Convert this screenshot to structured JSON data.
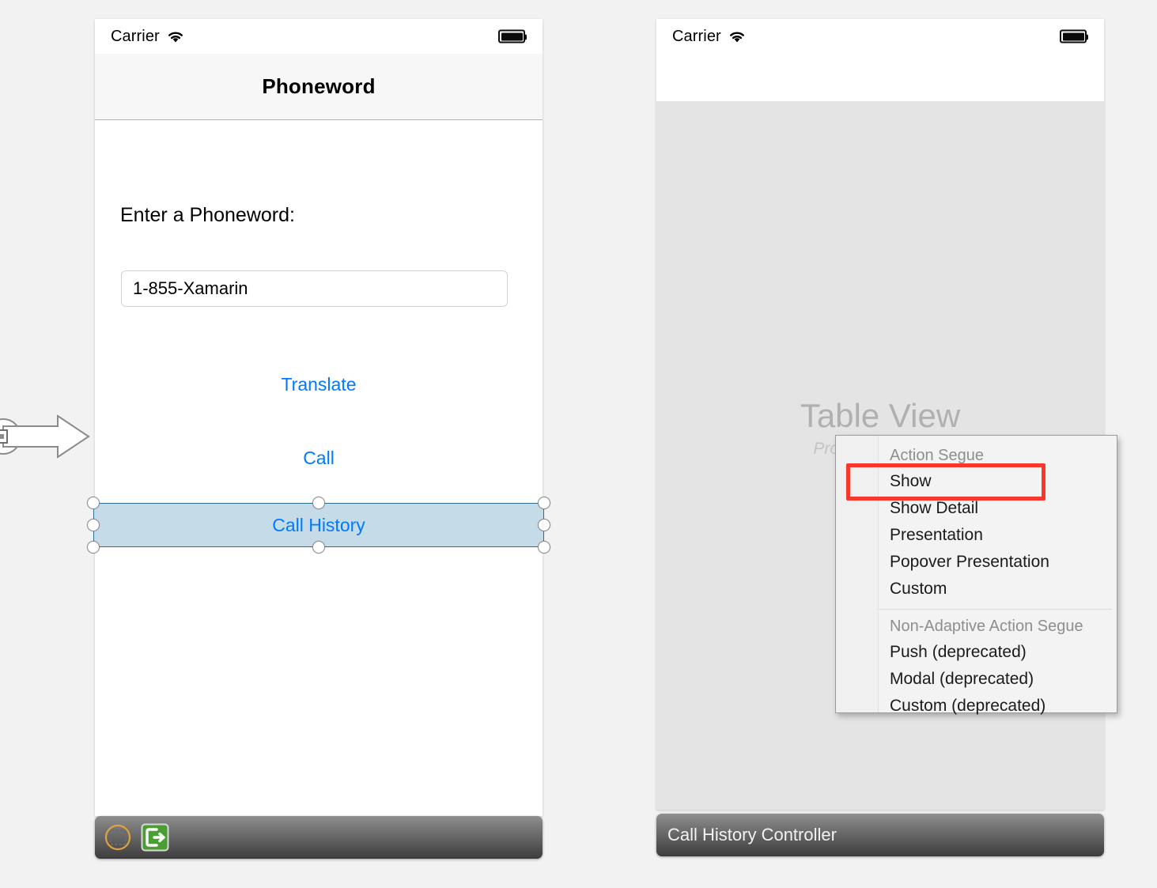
{
  "scene": {
    "canvas_bg": "#f2f2f2",
    "accent_blue": "#007aff",
    "selection_fill": "#c6dbe8",
    "selection_stroke": "#2b6f96",
    "highlight_red": "#f8382c"
  },
  "left_phone": {
    "status_bar": {
      "carrier": "Carrier",
      "wifi_icon": "wifi-icon",
      "battery_icon": "battery-full-icon"
    },
    "nav_title": "Phoneword",
    "field_label": "Enter a Phoneword:",
    "text_field": {
      "value": "1-855-Xamarin",
      "placeholder": "1-855-Xamarin"
    },
    "buttons": [
      {
        "label": "Translate",
        "name": "translate-button"
      },
      {
        "label": "Call",
        "name": "call-button"
      }
    ],
    "selected_button": {
      "label": "Call History",
      "name": "call-history-button",
      "selected": true,
      "handle_count": 6
    },
    "footer": {
      "icons": [
        {
          "name": "view-controller-icon",
          "title": "View Controller"
        },
        {
          "name": "exit-segue-icon",
          "title": "Exit"
        }
      ]
    }
  },
  "entry_point": {
    "name": "initial-view-controller-arrow",
    "label": "Initial View Controller"
  },
  "right_phone": {
    "status_bar": {
      "carrier": "Carrier",
      "wifi_icon": "wifi-icon",
      "battery_icon": "battery-full-icon"
    },
    "table_view": {
      "title": "Table View",
      "subtitle": "Prototype Content"
    },
    "footer": {
      "controller_title": "Call History Controller"
    }
  },
  "context_menu": {
    "sections": [
      {
        "header": "Action Segue",
        "items": [
          {
            "label": "Show",
            "highlighted": true
          },
          {
            "label": "Show Detail",
            "highlighted": false
          },
          {
            "label": "Presentation",
            "highlighted": false
          },
          {
            "label": "Popover Presentation",
            "highlighted": false
          },
          {
            "label": "Custom",
            "highlighted": false
          }
        ]
      },
      {
        "header": "Non-Adaptive Action Segue",
        "items": [
          {
            "label": "Push (deprecated)",
            "highlighted": false
          },
          {
            "label": "Modal (deprecated)",
            "highlighted": false
          },
          {
            "label": "Custom (deprecated)",
            "highlighted": false
          }
        ]
      }
    ]
  }
}
